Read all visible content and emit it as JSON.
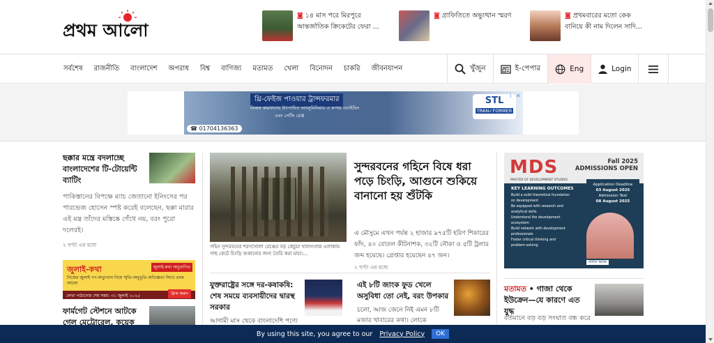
{
  "header": {
    "logo_text": "প্রথম আলো",
    "trending": [
      {
        "text": "১৪ মাস পরে মিরপুরে আন্তর্জাতিক ক্রিকেটের ফেরা ..."
      },
      {
        "text": "গ্রাফিতিতে অভ্যুত্থান স্মরণ"
      },
      {
        "text": "প্রথমবারের মতো কেক বানিয়ে কী নাম দিলেন সাদি..."
      }
    ]
  },
  "nav": {
    "items": [
      "সর্বশেষ",
      "রাজনীতি",
      "বাংলাদেশ",
      "অপরাধ",
      "বিশ্ব",
      "বাণিজ্য",
      "মতামত",
      "খেলা",
      "বিনোদন",
      "চাকরি",
      "জীবনযাপন"
    ],
    "search_label": "খুঁজুন",
    "epaper_label": "ই-পেপার",
    "language_label": "Eng",
    "login_label": "Login"
  },
  "ad_banner": {
    "title": "থ্রি-ফেইজ পাওয়ার ট্রান্সফরমার",
    "subtitle": "নিজস্ব কারখানায় উৎপাদিত অ্যালুমিনিয়াম ও কপার ওয়াইন্ডিং",
    "subtitle2": "এবং সেটিং রেঞ্জ",
    "phone": "01704136363",
    "brand": "STL",
    "brand_sub": "TRAN✓FORMER",
    "info": "i",
    "close": "✕"
  },
  "col1": {
    "story1_headline": "ছক্কার মন্ত্রে বদলাচ্ছে বাংলাদেশের টি-টোয়েন্টি ব্যাটিং",
    "story1_summary": "পাকিস্তানের বিপক্ষে ম্যাচ জেতানো ইনিংসের পর পারভেজ হোসেন স্পষ্ট করেই বলেছেন, ছক্কা মারার এই মন্ত্র তাঁদের মস্তিষ্কে গেঁথে নয়, বরং পুরো দলেরই।",
    "story1_time": "২ ঘণ্টা এর মধ্যে",
    "july_ad": {
      "title": "জুলাই-কথা",
      "badge": "জুলাই-কথা অনুপ্রাণিত",
      "line": "নিজের জুলাই গণ-অভ্যুত্থান নিয়ে স্মৃতি-অনুভূতি-অভিজ্ঞতা লিখে প্রথম আলো",
      "footer": "লেখা পাঠানোর শেষ সময়: ৩১ জুলাই ২০২৫",
      "button": "ক্লিক করুন"
    },
    "story2_headline": "ফার্মগেট স্টেশনে আটকে গেল মেট্রোরেল, কয়েক"
  },
  "lead": {
    "caption": "গহিন সুন্দরবনের শরণখোলা রেঞ্জের বড় কেচুয়া খালসংলগ্ন এলাকায় গাছ কেটে চিংড়ি শুকানোর জন্য তৈরি করা মাচা।...",
    "headline": "সুন্দরবনের গহিনে বিষে ধরা পড়ে চিংড়ি, আগুনে শুকিয়ে বানানো হয় শুঁটকি",
    "summary": "এ মৌসুমে এখন পর্যন্ত ২ হাজার ৯৭৫টি হরিণ শিকারের ফাঁদ, ৪০ বোতল কীটনাশক, ৩২টি নৌকা ও ৫টি ট্রলার জব্দ হয়েছে। গ্রেপ্তার হয়েছেন ৪৭ জন।",
    "time": "২ ঘণ্টা এর মধ্যে"
  },
  "sub_stories": [
    {
      "headline": "যুক্তরাষ্ট্রের সঙ্গে দর-কষাকষি: শেষ সময়ে ব্যবসায়ীদের দ্বারস্থ সরকার",
      "summary": "আগামী মাস থেকে বাংলাদেশি পণ্যে এই"
    },
    {
      "headline": "এই ৮টি জাংক ফুড খেলে অসুবিধা তো নেই, বরং উপকার",
      "summary": "চলো, আজ জেনে নিই এমন ৮টি মজার খাবারের কথা। লোকে এগুলোকে 'অপকারী'"
    }
  ],
  "col3": {
    "mds_ad": {
      "brand": "MDS",
      "brand_sub": "MASTER OF DEVELOPMENT STUDIES",
      "season": "Fall 2025",
      "admissions": "ADMISSIONS OPEN",
      "deadline_label": "Application Deadline",
      "deadline": "03 August 2025",
      "test_label": "Admission Test",
      "test": "08 August 2025",
      "outcomes_title": "KEY LEARNING OUTCOMES",
      "outcomes": [
        "Build a solid theoretical foundation on development",
        "Be equipped with research and analytical skills",
        "Understand the development ecosystem",
        "Build network with development professionals",
        "Foster critical thinking and problem-solving"
      ],
      "apply": "APPLY NOW"
    },
    "story_category": "মতামত",
    "story_headline": "গাজা থেকে ইউক্রেন—যে কারণে এত যুদ্ধ",
    "story_summary": "বর্তমানে বড় বড় সংঘাত বন্ধ করে"
  },
  "cookie": {
    "text": "By using this site, you agree to our",
    "link": "Privacy Policy",
    "ok": "OK"
  },
  "colors": {
    "brand_red": "#d0201f",
    "cookie_bg": "#0c2a55",
    "ok_button": "#2f6fd6"
  }
}
